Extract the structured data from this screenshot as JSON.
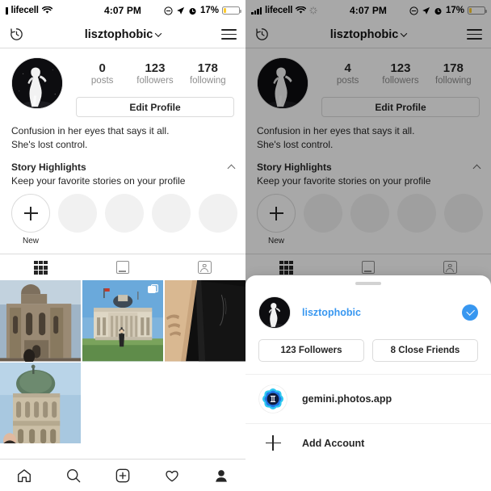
{
  "left": {
    "status": {
      "carrier": "lifecell",
      "time": "4:07 PM",
      "battery_pct": "17%",
      "icons": [
        "signal-bar-icon",
        "wifi-icon",
        "do-not-disturb-icon",
        "location-arrow-icon",
        "alarm-icon",
        "battery-icon"
      ]
    },
    "nav": {
      "archive_icon": "clock-history-icon",
      "title": "lisztophobic",
      "menu_icon": "hamburger-menu-icon"
    },
    "profile": {
      "stats": [
        {
          "num": "0",
          "label": "posts"
        },
        {
          "num": "123",
          "label": "followers"
        },
        {
          "num": "178",
          "label": "following"
        }
      ],
      "edit_label": "Edit Profile",
      "bio_line1": "Confusion in her eyes that says it all.",
      "bio_line2": "She's lost control."
    },
    "highlights": {
      "title": "Story Highlights",
      "subtitle": "Keep your favorite stories on your profile",
      "new_label": "New",
      "placeholder_count": 4
    },
    "tabs": [
      {
        "name": "grid-tab",
        "icon": "grid-icon",
        "active": true
      },
      {
        "name": "list-tab",
        "icon": "portrait-icon",
        "active": false
      },
      {
        "name": "tagged-tab",
        "icon": "tagged-person-icon",
        "active": false
      }
    ],
    "photos": [
      {
        "alt": "berlin-cathedral",
        "carousel": false
      },
      {
        "alt": "reichstag-building",
        "carousel": true
      },
      {
        "alt": "black-canvas-artwork",
        "carousel": false
      },
      {
        "alt": "cathedral-dome",
        "carousel": false
      }
    ],
    "bottom_nav": [
      "home-icon",
      "search-icon",
      "add-post-icon",
      "activity-heart-icon",
      "profile-icon"
    ]
  },
  "right": {
    "status": {
      "carrier": "lifecell",
      "time": "4:07 PM",
      "battery_pct": "17%"
    },
    "nav": {
      "title": "lisztophobic"
    },
    "profile": {
      "stats": [
        {
          "num": "4",
          "label": "posts"
        },
        {
          "num": "123",
          "label": "followers"
        },
        {
          "num": "178",
          "label": "following"
        }
      ],
      "edit_label": "Edit Profile",
      "bio_line1": "Confusion in her eyes that says it all.",
      "bio_line2": "She's lost control."
    },
    "highlights": {
      "title": "Story Highlights",
      "subtitle": "Keep your favorite stories on your profile",
      "new_label": "New"
    },
    "sheet": {
      "account_name": "lisztophobic",
      "verified": true,
      "followers_pill": "123 Followers",
      "close_friends_pill": "8 Close Friends",
      "second_account": "gemini.photos.app",
      "add_account_label": "Add Account"
    }
  },
  "colors": {
    "accent_blue": "#3897F0",
    "battery_yellow": "#FDCB2F",
    "border": "#dbdbdb",
    "muted": "#8e8e8e"
  }
}
